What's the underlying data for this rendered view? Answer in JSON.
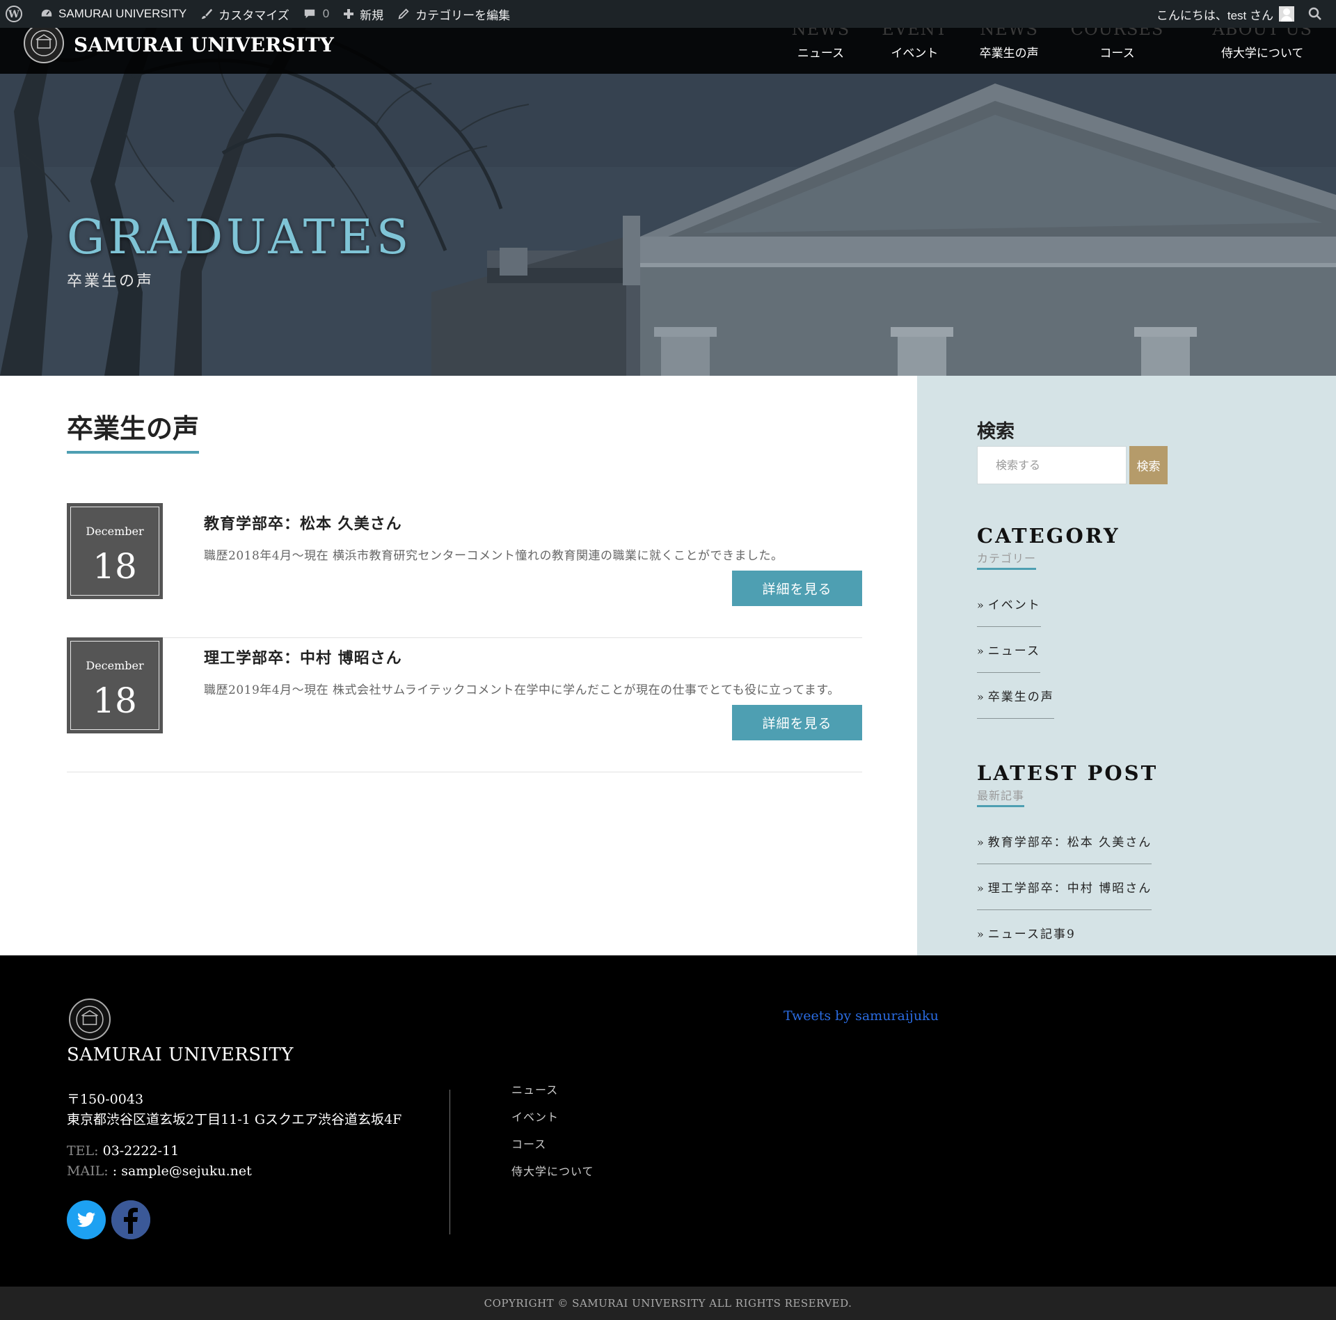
{
  "adminbar": {
    "site_name": "SAMURAI UNIVERSITY",
    "customize": "カスタマイズ",
    "comments_count": "0",
    "new": "新規",
    "edit_category": "カテゴリーを編集",
    "greeting": "こんにちは、test さん"
  },
  "header": {
    "site_title": "SAMURAI UNIVERSITY",
    "nav": [
      {
        "en": "NEWS",
        "ja": "ニュース"
      },
      {
        "en": "EVENT",
        "ja": "イベント"
      },
      {
        "en": "NEWS",
        "ja": "卒業生の声"
      },
      {
        "en": "COURSES",
        "ja": "コース"
      },
      {
        "en": "ABOUT US",
        "ja": "侍大学について"
      }
    ]
  },
  "hero": {
    "title": "GRADUATES",
    "subtitle": "卒業生の声"
  },
  "main": {
    "heading": "卒業生の声",
    "posts": [
      {
        "month": "December",
        "day": "18",
        "title": "教育学部卒：松本 久美さん",
        "excerpt": "職歴2018年4月～現在 横浜市教育研究センターコメント憧れの教育関連の職業に就くことができました。",
        "button": "詳細を見る"
      },
      {
        "month": "December",
        "day": "18",
        "title": "理工学部卒：中村 博昭さん",
        "excerpt": "職歴2019年4月～現在 株式会社サムライテックコメント在学中に学んだことが現在の仕事でとても役に立ってます。",
        "button": "詳細を見る"
      }
    ]
  },
  "sidebar": {
    "search": {
      "title": "検索",
      "placeholder": "検索する",
      "button": "検索"
    },
    "category": {
      "title_en": "CATEGORY",
      "title_ja": "カテゴリー",
      "items": [
        "イベント",
        "ニュース",
        "卒業生の声"
      ]
    },
    "latest": {
      "title_en": "LATEST POST",
      "title_ja": "最新記事",
      "items": [
        "教育学部卒：松本 久美さん",
        "理工学部卒：中村 博昭さん",
        "ニュース記事9"
      ]
    }
  },
  "footer": {
    "site_title": "SAMURAI UNIVERSITY",
    "postal": "〒150-0043",
    "address": "東京都渋谷区道玄坂2丁目11-1 Gスクエア渋谷道玄坂4F",
    "tel_label": "TEL:",
    "tel": "03-2222-11",
    "mail_label": "MAIL:",
    "mail": ": sample@sejuku.net",
    "nav": [
      "ニュース",
      "イベント",
      "コース",
      "侍大学について"
    ],
    "tweets": "Tweets by samuraijuku",
    "copyright": "COPYRIGHT © SAMURAI UNIVERSITY ALL RIGHTS RESERVED."
  },
  "colors": {
    "accent": "#4e9fb2",
    "hero_title": "#7fc4d6",
    "search_button": "#b59b6a",
    "sidebar_bg": "#d5e3e6",
    "date_box": "#555555",
    "twitter": "#1da1f2",
    "facebook": "#3b5998"
  }
}
